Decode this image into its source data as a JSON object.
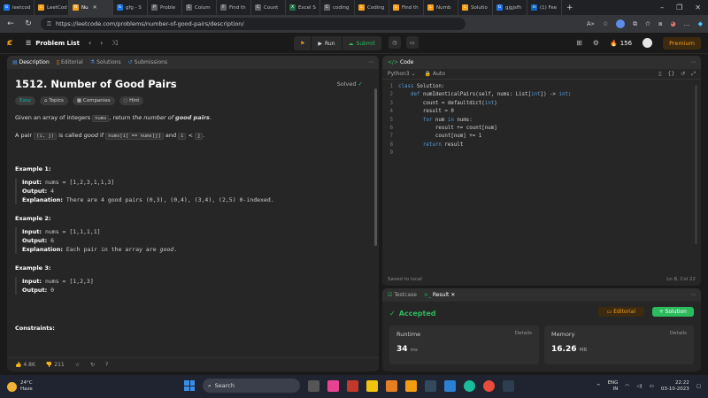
{
  "browser": {
    "tabs": [
      {
        "label": "leetcod",
        "icon": "G",
        "color": "#1a73e8"
      },
      {
        "label": "LeetCod",
        "icon": "L",
        "color": "#f89f1b"
      },
      {
        "label": "Nu",
        "icon": "N",
        "color": "#f89f1b",
        "active": true
      },
      {
        "label": "gfg - S",
        "icon": "G",
        "color": "#1a73e8"
      },
      {
        "label": "Proble",
        "icon": "P",
        "color": "#5f6368"
      },
      {
        "label": "Colum",
        "icon": "C",
        "color": "#5f6368"
      },
      {
        "label": "Find th",
        "icon": "F",
        "color": "#5f6368"
      },
      {
        "label": "Count",
        "icon": "C",
        "color": "#5f6368"
      },
      {
        "label": "Excel S",
        "icon": "X",
        "color": "#1e7145"
      },
      {
        "label": "coding",
        "icon": "C",
        "color": "#5f6368"
      },
      {
        "label": "Coding",
        "icon": "L",
        "color": "#f89f1b"
      },
      {
        "label": "Find th",
        "icon": "L",
        "color": "#f89f1b"
      },
      {
        "label": "Numb",
        "icon": "L",
        "color": "#f89f1b"
      },
      {
        "label": "Solutio",
        "icon": "L",
        "color": "#f89f1b"
      },
      {
        "label": "gjgjsfh",
        "icon": "G",
        "color": "#1a73e8"
      },
      {
        "label": "(1) Fee",
        "icon": "in",
        "color": "#0a66c2"
      }
    ],
    "url": "https://leetcode.com/problems/number-of-good-pairs/description/"
  },
  "nav": {
    "problem_list": "Problem List",
    "run": "Run",
    "submit": "Submit",
    "streak": "156",
    "premium": "Premium"
  },
  "desc": {
    "tabs": [
      "Description",
      "Editorial",
      "Solutions",
      "Submissions"
    ],
    "title": "1512. Number of Good Pairs",
    "solved": "Solved",
    "chips": [
      "Easy",
      "Topics",
      "Companies",
      "Hint"
    ],
    "p1_a": "Given an array of integers ",
    "p1_code": "nums",
    "p1_b": ", return ",
    "p1_em": "the number of ",
    "p1_strong": "good pairs",
    "p1_end": ".",
    "p2_a": "A pair ",
    "p2_code1": "(i, j)",
    "p2_b": " is called ",
    "p2_em": "good",
    "p2_c": " if ",
    "p2_code2": "nums[i] == nums[j]",
    "p2_d": " and ",
    "p2_code3": "i",
    "p2_e": " < ",
    "p2_code4": "j",
    "p2_f": ".",
    "ex1_title": "Example 1:",
    "ex1_input": "nums = [1,2,3,1,1,3]",
    "ex1_output": "4",
    "ex1_expl": "There are 4 good pairs (0,3), (0,4), (3,4), (2,5) 0-indexed.",
    "ex2_title": "Example 2:",
    "ex2_input": "nums = [1,1,1,1]",
    "ex2_output": "6",
    "ex2_expl_a": "Each pair in the array are ",
    "ex2_expl_em": "good",
    "ex2_expl_b": ".",
    "ex3_title": "Example 3:",
    "ex3_input": "nums = [1,2,3]",
    "ex3_output": "0",
    "constraints": "Constraints:",
    "input_label": "Input:",
    "output_label": "Output:",
    "expl_label": "Explanation:",
    "likes": "4.8K",
    "dislikes": "211"
  },
  "code": {
    "tab": "Code",
    "language": "Python3",
    "mode": "Auto",
    "lines": [
      "class Solution:",
      "    def numIdenticalPairs(self, nums: List[int]) -> int:",
      "        count = defaultdict(int)",
      "        result = 0",
      "        for num in nums:",
      "            result += count[num]",
      "            count[num] += 1",
      "        return result",
      ""
    ],
    "saved": "Saved to local",
    "position": "Ln 8, Col 22"
  },
  "result": {
    "tabs": [
      "Testcase",
      "Result"
    ],
    "status": "Accepted",
    "editorial": "Editorial",
    "solution": "Solution",
    "runtime_label": "Runtime",
    "runtime_value": "34",
    "runtime_unit": "ms",
    "memory_label": "Memory",
    "memory_value": "16.26",
    "memory_unit": "MB",
    "details": "Details"
  },
  "taskbar": {
    "temp": "24°C",
    "weather": "Haze",
    "search": "Search",
    "lang": "ENG",
    "region": "IN",
    "time": "22:22",
    "date": "03-10-2023"
  }
}
